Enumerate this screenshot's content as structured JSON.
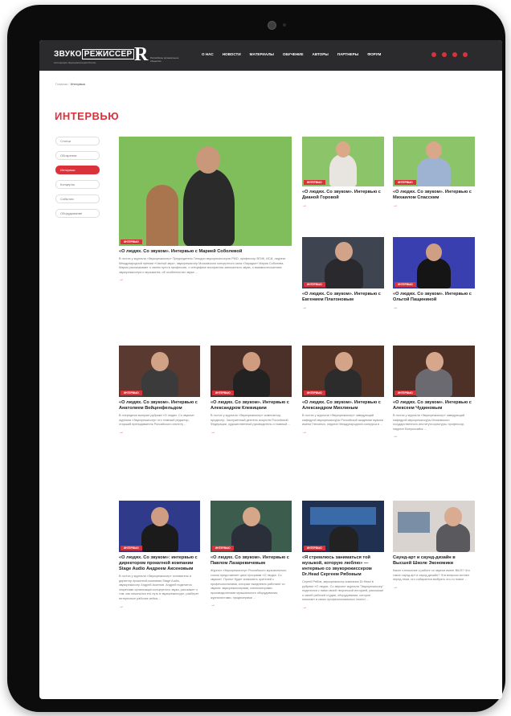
{
  "site": {
    "logo_word1": "ЗВУКО",
    "logo_word2": "РЕЖИССЕР",
    "logo_sub": "Ассоциация звукорежиссеров России",
    "r_logo": "R",
    "r_sub": "Российское музыкальное общество"
  },
  "nav": [
    "О НАС",
    "НОВОСТИ",
    "МАТЕРИАЛЫ",
    "ОБУЧЕНИЕ",
    "АВТОРЫ",
    "ПАРТНЕРЫ",
    "ФОРУМ"
  ],
  "breadcrumb": {
    "home": "Главная",
    "sep": " / ",
    "current": "Интервью"
  },
  "page_title": "ИНТЕРВЬЮ",
  "filters": [
    {
      "label": "Статьи",
      "active": false
    },
    {
      "label": "Обозрения",
      "active": false
    },
    {
      "label": "Интервью",
      "active": true
    },
    {
      "label": "Концерты",
      "active": false
    },
    {
      "label": "События",
      "active": false
    },
    {
      "label": "Оборудование",
      "active": false
    }
  ],
  "badge_label": "ИНТЕРВЬЮ",
  "arrow": "→",
  "colors": {
    "accent": "#d9323a",
    "topbar": "#2b2b2e",
    "tablet": "#0c0c0c"
  },
  "cards": [
    {
      "title": "«О людях. Со звуком». Интервью с Марией Соболевой",
      "desc": "В гостях у журнала «Звукорежиссер» Председатель Гильдии звукорежиссеров РМО, профессор ВГИК, ИСИ, лауреат Международной премии «Чистый звук», звукорежиссер Московского концертного зала «Зарядье» Мария Соболева. Мария рассказывает о своем пути в профессии, о специфике восприятия записанного звука, о взаимоотношениях звукорежиссера и музыканта, об особенностях звука ..."
    },
    {
      "title": "«О людях. Со звуком». Интервью с Дианой Горовой",
      "desc": ""
    },
    {
      "title": "«О людях. Со звуком». Интервью с Михаилом Спасским",
      "desc": ""
    },
    {
      "title": "«О людях. Со звуком». Интервью с Евгением Платоновым",
      "desc": ""
    },
    {
      "title": "«О людях. Со звуком». Интервью с Ольгой Пащининой",
      "desc": ""
    },
    {
      "title": "«О людях. Со звуком». Интервью с Анатолием Вейценфельдом",
      "desc": "В очередном выпуске рубрики «О людях. Со звуком» журнала «Звукорежиссер» его главный редактор, старший преподаватель Российского институ ..."
    },
    {
      "title": "«О людях. Со звуком». Интервью с Александром Клевицким",
      "desc": "В гостях у журнала «Звукорежиссер» композитор, продюсер, Заслуженный деятель искусств Российской Федерации, художественный руководитель и главный ..."
    },
    {
      "title": "«О людях. Со звуком». Интервью с Александром Михлиным",
      "desc": "В гостях у журнала «Звукорежиссер» заведующий кафедрой звукорежиссуры Российской академии музыки имени Гнесиных, лауреат Международного конкурса в ..."
    },
    {
      "title": "«О людях. Со звуком». Интервью с Алексеем Чудиновым",
      "desc": "В гостях у журнала «Звукорежиссер» заведующий кафедрой звукорежиссуры Московского государственного института культуры, профессор, лауреат Всероссийск ..."
    },
    {
      "title": "«О людях. Со звуком»: интервью с директором прокатной компании Stage Audio Андреем Аксеновым",
      "desc": "В гостях у журнала «Звукорежиссер» основатель и директор прокатной компании Stage Audio, звукорежиссер Андрей Аксенов. Андрей поделится секретами организации концертного звука, расскажет о том, как начинался его путь в звукорежиссуре, разберет интересные рабочие кейсы ..."
    },
    {
      "title": "«О людях. Со звуком». Интервью с Павлом Лазаревичевым",
      "desc": "Журнал «Звукорежиссер» Российского музыкального союза представляет цикл программ «О людях. Со звуком». Проект будет знакомить зрителей с профессионалами, которые ежедневно работают со звуком: звукорежиссерами, композиторами, производителями музыкального оборудования, журналистами, продюсерами ..."
    },
    {
      "title": "«Я стремлюсь заниматься той музыкой, которую люблю» — интервью со звукорежиссером Dr.Head Сергеем Рябовым",
      "desc": "Сергей Рябов, звукорежиссер компании Dr.Head в рубрике «О людях. Со звуком» журнала \"Звукорежиссер\" поделился с нами своей творческой историей, рассказал о своей рабочей студии, оборудовании, которое помогает в своих профессиональных хлопот ..."
    },
    {
      "title": "Саунд-арт и саунд-дизайн в Высшей Школе Экономики",
      "desc": "Какое отношение к работе со звуком имеет ВШЭ? Что такое саунд-арт и саунд-дизайн? Эти вопросы встают перед теми, кто собирается выбрать что-то новое ..."
    }
  ]
}
